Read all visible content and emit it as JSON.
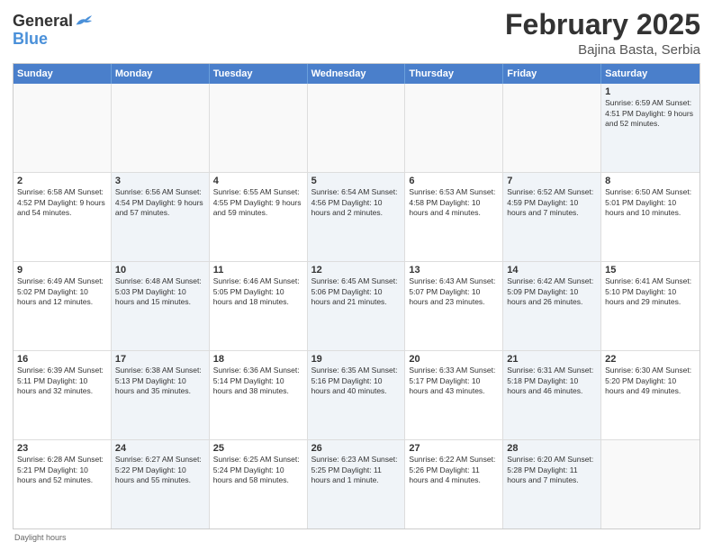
{
  "header": {
    "logo_general": "General",
    "logo_blue": "Blue",
    "title": "February 2025",
    "subtitle": "Bajina Basta, Serbia"
  },
  "calendar": {
    "days_of_week": [
      "Sunday",
      "Monday",
      "Tuesday",
      "Wednesday",
      "Thursday",
      "Friday",
      "Saturday"
    ],
    "rows": [
      [
        {
          "day": "",
          "content": "",
          "empty": true
        },
        {
          "day": "",
          "content": "",
          "empty": true
        },
        {
          "day": "",
          "content": "",
          "empty": true
        },
        {
          "day": "",
          "content": "",
          "empty": true
        },
        {
          "day": "",
          "content": "",
          "empty": true
        },
        {
          "day": "",
          "content": "",
          "empty": true
        },
        {
          "day": "1",
          "content": "Sunrise: 6:59 AM\nSunset: 4:51 PM\nDaylight: 9 hours and 52 minutes.",
          "shaded": true
        }
      ],
      [
        {
          "day": "2",
          "content": "Sunrise: 6:58 AM\nSunset: 4:52 PM\nDaylight: 9 hours and 54 minutes.",
          "shaded": false
        },
        {
          "day": "3",
          "content": "Sunrise: 6:56 AM\nSunset: 4:54 PM\nDaylight: 9 hours and 57 minutes.",
          "shaded": true
        },
        {
          "day": "4",
          "content": "Sunrise: 6:55 AM\nSunset: 4:55 PM\nDaylight: 9 hours and 59 minutes.",
          "shaded": false
        },
        {
          "day": "5",
          "content": "Sunrise: 6:54 AM\nSunset: 4:56 PM\nDaylight: 10 hours and 2 minutes.",
          "shaded": true
        },
        {
          "day": "6",
          "content": "Sunrise: 6:53 AM\nSunset: 4:58 PM\nDaylight: 10 hours and 4 minutes.",
          "shaded": false
        },
        {
          "day": "7",
          "content": "Sunrise: 6:52 AM\nSunset: 4:59 PM\nDaylight: 10 hours and 7 minutes.",
          "shaded": true
        },
        {
          "day": "8",
          "content": "Sunrise: 6:50 AM\nSunset: 5:01 PM\nDaylight: 10 hours and 10 minutes.",
          "shaded": false
        }
      ],
      [
        {
          "day": "9",
          "content": "Sunrise: 6:49 AM\nSunset: 5:02 PM\nDaylight: 10 hours and 12 minutes.",
          "shaded": false
        },
        {
          "day": "10",
          "content": "Sunrise: 6:48 AM\nSunset: 5:03 PM\nDaylight: 10 hours and 15 minutes.",
          "shaded": true
        },
        {
          "day": "11",
          "content": "Sunrise: 6:46 AM\nSunset: 5:05 PM\nDaylight: 10 hours and 18 minutes.",
          "shaded": false
        },
        {
          "day": "12",
          "content": "Sunrise: 6:45 AM\nSunset: 5:06 PM\nDaylight: 10 hours and 21 minutes.",
          "shaded": true
        },
        {
          "day": "13",
          "content": "Sunrise: 6:43 AM\nSunset: 5:07 PM\nDaylight: 10 hours and 23 minutes.",
          "shaded": false
        },
        {
          "day": "14",
          "content": "Sunrise: 6:42 AM\nSunset: 5:09 PM\nDaylight: 10 hours and 26 minutes.",
          "shaded": true
        },
        {
          "day": "15",
          "content": "Sunrise: 6:41 AM\nSunset: 5:10 PM\nDaylight: 10 hours and 29 minutes.",
          "shaded": false
        }
      ],
      [
        {
          "day": "16",
          "content": "Sunrise: 6:39 AM\nSunset: 5:11 PM\nDaylight: 10 hours and 32 minutes.",
          "shaded": false
        },
        {
          "day": "17",
          "content": "Sunrise: 6:38 AM\nSunset: 5:13 PM\nDaylight: 10 hours and 35 minutes.",
          "shaded": true
        },
        {
          "day": "18",
          "content": "Sunrise: 6:36 AM\nSunset: 5:14 PM\nDaylight: 10 hours and 38 minutes.",
          "shaded": false
        },
        {
          "day": "19",
          "content": "Sunrise: 6:35 AM\nSunset: 5:16 PM\nDaylight: 10 hours and 40 minutes.",
          "shaded": true
        },
        {
          "day": "20",
          "content": "Sunrise: 6:33 AM\nSunset: 5:17 PM\nDaylight: 10 hours and 43 minutes.",
          "shaded": false
        },
        {
          "day": "21",
          "content": "Sunrise: 6:31 AM\nSunset: 5:18 PM\nDaylight: 10 hours and 46 minutes.",
          "shaded": true
        },
        {
          "day": "22",
          "content": "Sunrise: 6:30 AM\nSunset: 5:20 PM\nDaylight: 10 hours and 49 minutes.",
          "shaded": false
        }
      ],
      [
        {
          "day": "23",
          "content": "Sunrise: 6:28 AM\nSunset: 5:21 PM\nDaylight: 10 hours and 52 minutes.",
          "shaded": false
        },
        {
          "day": "24",
          "content": "Sunrise: 6:27 AM\nSunset: 5:22 PM\nDaylight: 10 hours and 55 minutes.",
          "shaded": true
        },
        {
          "day": "25",
          "content": "Sunrise: 6:25 AM\nSunset: 5:24 PM\nDaylight: 10 hours and 58 minutes.",
          "shaded": false
        },
        {
          "day": "26",
          "content": "Sunrise: 6:23 AM\nSunset: 5:25 PM\nDaylight: 11 hours and 1 minute.",
          "shaded": true
        },
        {
          "day": "27",
          "content": "Sunrise: 6:22 AM\nSunset: 5:26 PM\nDaylight: 11 hours and 4 minutes.",
          "shaded": false
        },
        {
          "day": "28",
          "content": "Sunrise: 6:20 AM\nSunset: 5:28 PM\nDaylight: 11 hours and 7 minutes.",
          "shaded": true
        },
        {
          "day": "",
          "content": "",
          "empty": true
        }
      ]
    ]
  },
  "footer": {
    "note": "Daylight hours"
  }
}
